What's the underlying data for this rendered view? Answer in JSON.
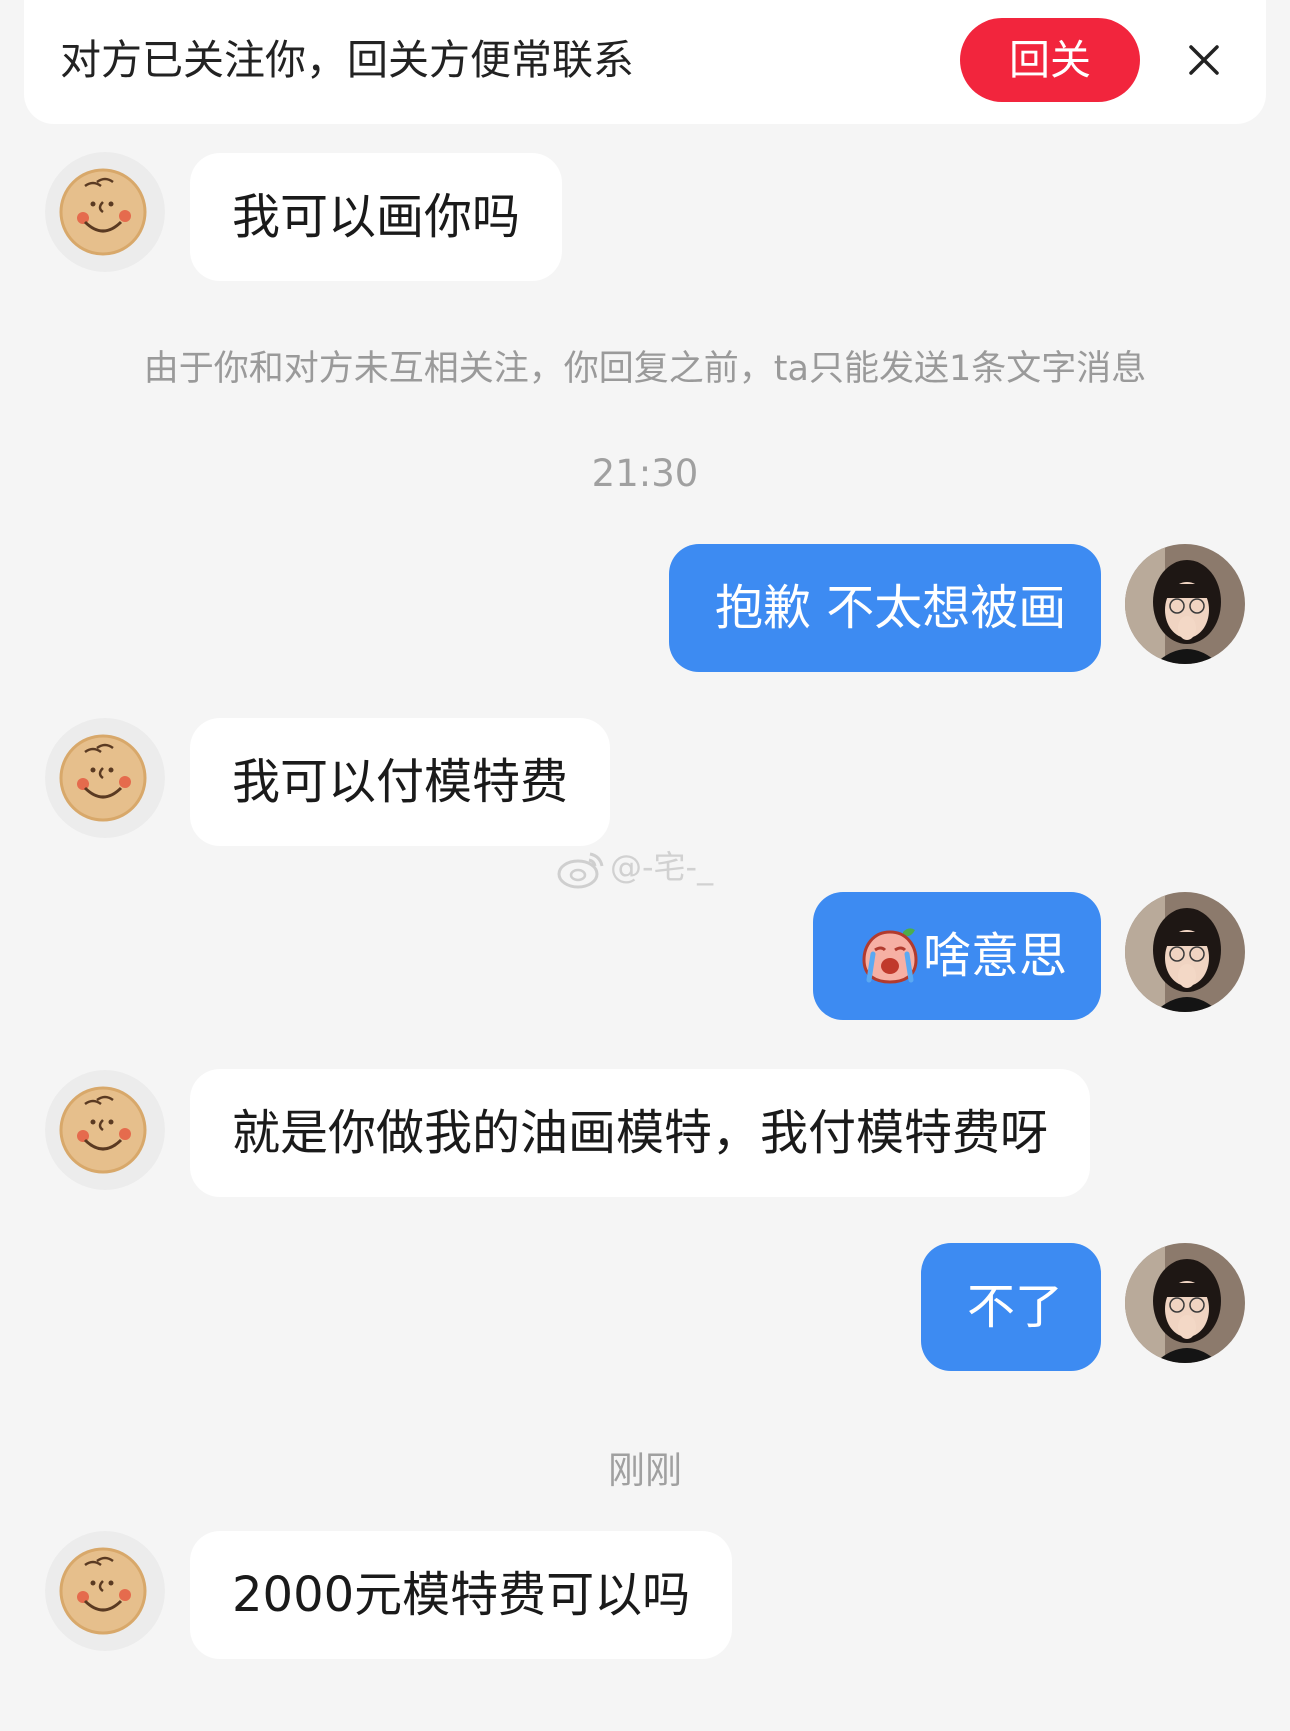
{
  "banner": {
    "text": "对方已关注你，回关方便常联系",
    "follow_back_label": "回关",
    "close_icon": "close-icon"
  },
  "system_note": "由于你和对方未互相关注，你回复之前，ta只能发送1条文字消息",
  "times": {
    "first": "21:30",
    "second": "刚刚"
  },
  "messages": [
    {
      "side": "left",
      "text": "我可以画你吗"
    },
    {
      "side": "right",
      "text": "抱歉 不太想被画"
    },
    {
      "side": "left",
      "text": "我可以付模特费"
    },
    {
      "side": "right",
      "text": "啥意思",
      "emoji": "crying-peach-emoji"
    },
    {
      "side": "left",
      "text": "就是你做我的油画模特，我付模特费呀"
    },
    {
      "side": "right",
      "text": "不了"
    },
    {
      "side": "left",
      "text": "2000元模特费可以吗"
    }
  ],
  "watermark": {
    "text": "@-宅-_",
    "icon": "weibo-icon"
  },
  "colors": {
    "background": "#f5f5f5",
    "follow_button": "#f2253d",
    "sent_bubble": "#3d8bf2",
    "received_bubble": "#ffffff"
  }
}
